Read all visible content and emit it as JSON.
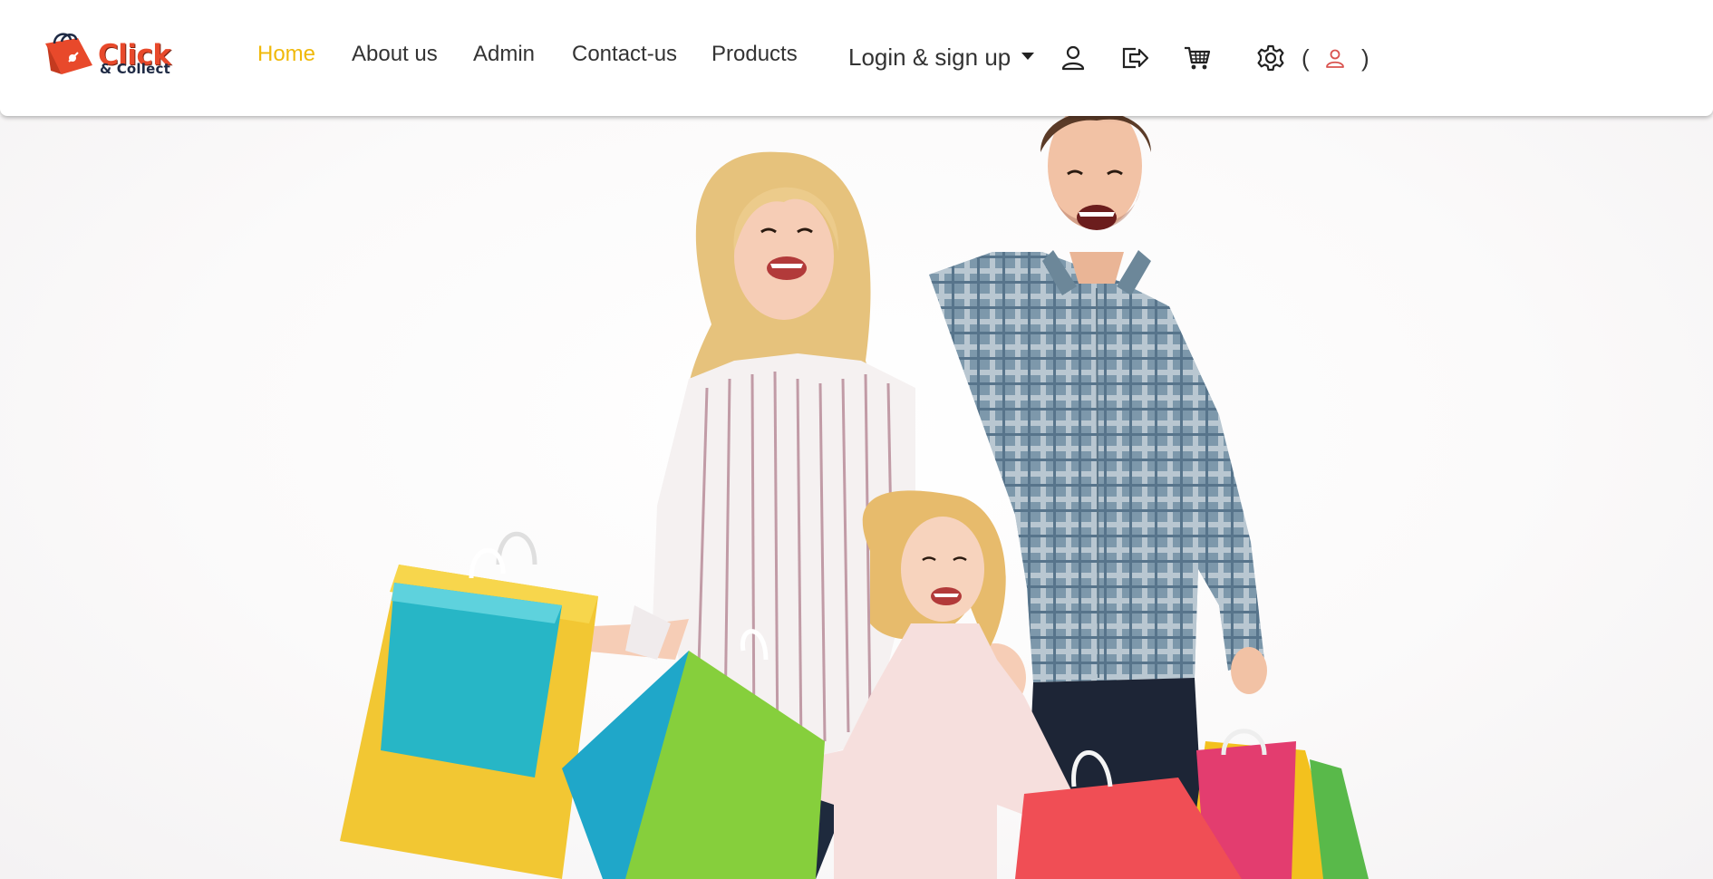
{
  "brand": {
    "line1": "Click",
    "line2": "& Collect",
    "colors": {
      "primary": "#e8492b",
      "secondary": "#1e2a44"
    }
  },
  "nav": {
    "links": [
      {
        "label": "Home",
        "active": true
      },
      {
        "label": "About us",
        "active": false
      },
      {
        "label": "Admin",
        "active": false
      },
      {
        "label": "Contact-us",
        "active": false
      },
      {
        "label": "Products",
        "active": false
      }
    ],
    "dropdown_label": "Login & sign up",
    "icons": [
      "user-icon",
      "logout-icon",
      "cart-icon",
      "gear-icon",
      "user-status-icon"
    ],
    "paren_open": "(",
    "paren_close": ")",
    "active_color": "#f0b90b"
  },
  "hero": {
    "image": "family-with-shopping-bags-photo"
  }
}
